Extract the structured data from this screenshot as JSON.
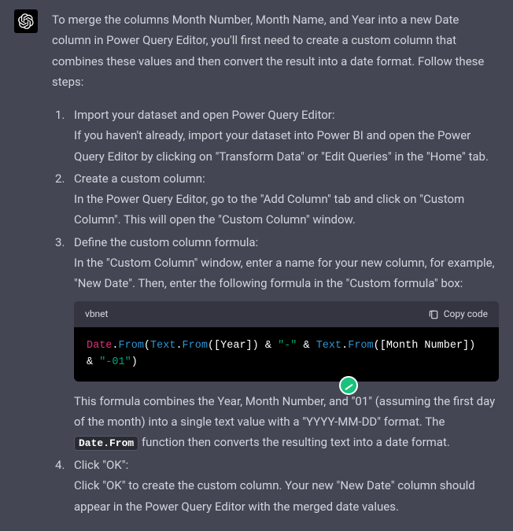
{
  "intro": "To merge the columns Month Number, Month Name, and Year into a new Date column in Power Query Editor, you'll first need to create a custom column that combines these values and then convert the result into a date format. Follow these steps:",
  "steps": [
    {
      "title": "Import your dataset and open Power Query Editor:",
      "body": "If you haven't already, import your dataset into Power BI and open the Power Query Editor by clicking on \"Transform Data\" or \"Edit Queries\" in the \"Home\" tab."
    },
    {
      "title": "Create a custom column:",
      "body": "In the Power Query Editor, go to the \"Add Column\" tab and click on \"Custom Column\". This will open the \"Custom Column\" window."
    },
    {
      "title": "Define the custom column formula:",
      "body": "In the \"Custom Column\" window, enter a name for your new column, for example, \"New Date\". Then, enter the following formula in the \"Custom formula\" box:",
      "after_a": "This formula combines the Year, Month Number, and \"01\" (assuming the first day of the month) into a single text value with a \"YYYY-MM-DD\" format. The ",
      "after_code": "Date.From",
      "after_b": " function then converts the resulting text into a date format."
    },
    {
      "title": "Click \"OK\":",
      "body": "Click \"OK\" to create the custom column. Your new \"New Date\" column should appear in the Power Query Editor with the merged date values."
    }
  ],
  "codeblock": {
    "lang": "vbnet",
    "copy_label": "Copy code",
    "tokens": {
      "t1": "Date",
      "t2": ".",
      "t3": "From",
      "t4": "(",
      "t5": "Text",
      "t6": ".",
      "t7": "From",
      "t8": "([Year]) & ",
      "t9": "\"-\"",
      "t10": " & ",
      "t11": "Text",
      "t12": ".",
      "t13": "From",
      "t14": "([Month Number]) & ",
      "t15": "\"-01\"",
      "t16": ")"
    }
  }
}
